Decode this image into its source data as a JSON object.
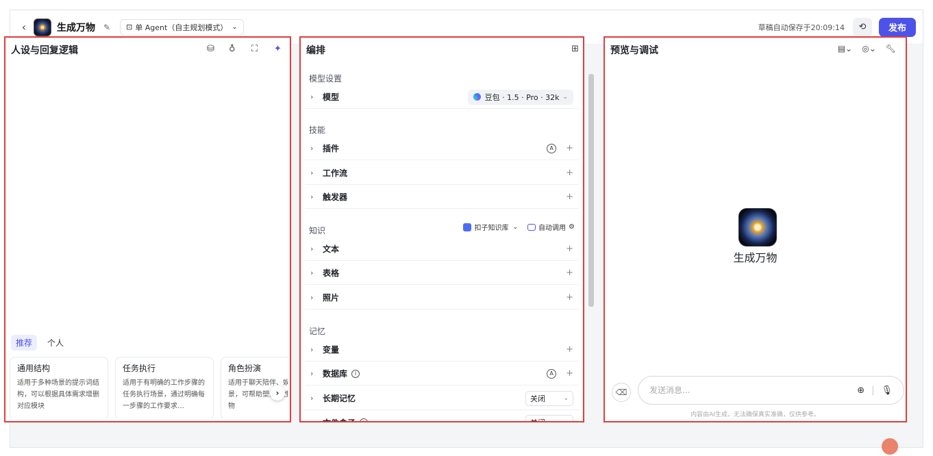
{
  "topbar": {
    "app_name": "生成万物",
    "mode_label": "单 Agent（自主规划模式）",
    "save_status": "草稿自动保存于20:09:14",
    "publish_label": "发布"
  },
  "left": {
    "title": "人设与回复逻辑",
    "tabs": [
      "推荐",
      "个人"
    ],
    "cards": [
      {
        "title": "通用结构",
        "desc": "适用于多种场景的提示词结构，可以根据具体需求增删对应模块"
      },
      {
        "title": "任务执行",
        "desc": "适用于有明确的工作步骤的任务执行场景，通过明确每一步骤的工作要求…"
      },
      {
        "title": "角色扮演",
        "desc": "适用于聊天陪伴、娱乐场景，可帮助塑造个性化的人物"
      }
    ]
  },
  "mid": {
    "title": "编排",
    "model_section": "模型设置",
    "model_label": "模型",
    "model_value": "豆包 · 1.5 · Pro · 32k",
    "skills_section": "技能",
    "skills": [
      "插件",
      "工作流",
      "触发器"
    ],
    "knowledge_section": "知识",
    "kb_label": "扣子知识库",
    "auto_label": "自动调用",
    "knowledge": [
      "文本",
      "表格",
      "照片"
    ],
    "memory_section": "记忆",
    "memory": [
      "变量",
      "数据库",
      "长期记忆",
      "文件盒子"
    ],
    "off_label": "关闭"
  },
  "right": {
    "title": "预览与调试",
    "bot_name": "生成万物",
    "placeholder": "发送消息...",
    "disclaimer": "内容由AI生成，无法确保真实准确，仅供参考。"
  }
}
